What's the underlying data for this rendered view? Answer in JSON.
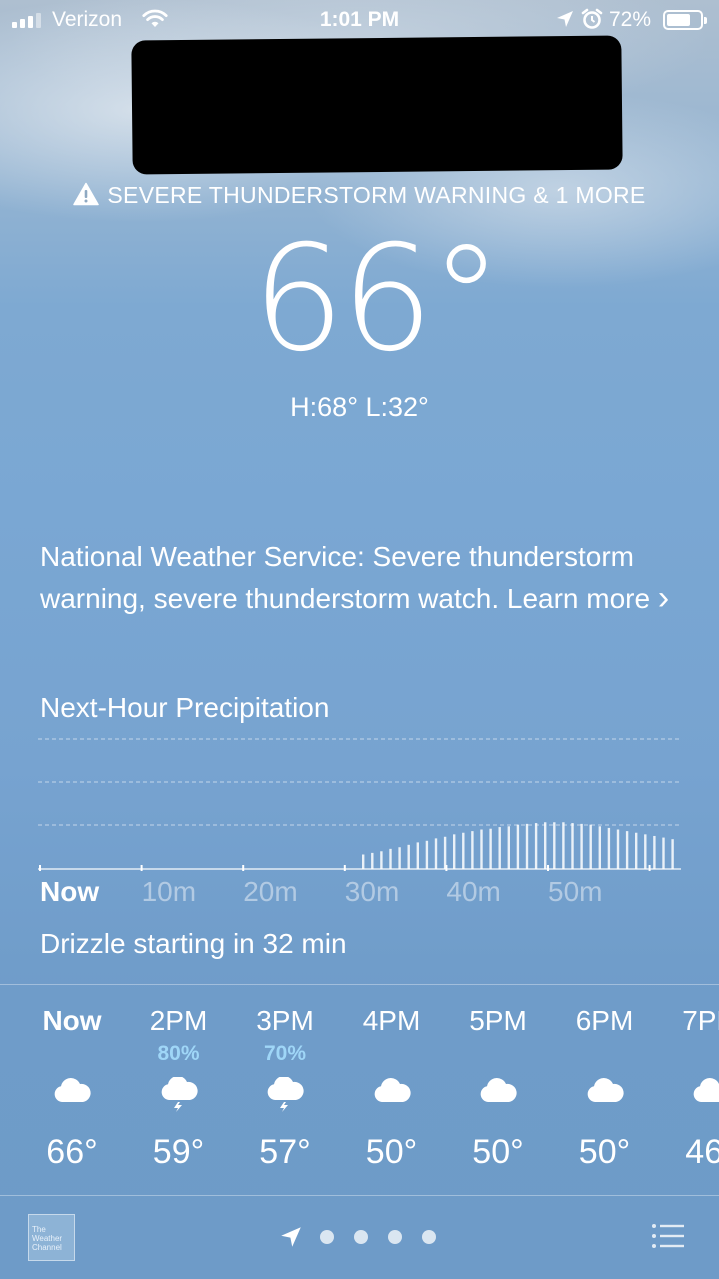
{
  "status_bar": {
    "carrier": "Verizon",
    "time": "1:01 PM",
    "battery_percent": "72%",
    "battery_level": 0.72
  },
  "warning": {
    "icon": "warning-triangle-icon",
    "text": "SEVERE THUNDERSTORM WARNING & 1 MORE"
  },
  "current": {
    "temperature": "66°",
    "high_low": "H:68°  L:32°"
  },
  "alert": {
    "text": "National Weather Service: Severe thunderstorm warning, severe thunderstorm watch. Learn more",
    "chevron": "›"
  },
  "precipitation": {
    "title": "Next-Hour Precipitation",
    "axis_labels": [
      "Now",
      "10m",
      "20m",
      "30m",
      "40m",
      "50m"
    ],
    "summary": "Drizzle starting in 32 min",
    "intensity_by_minute_from_32": [
      0.18,
      0.2,
      0.22,
      0.25,
      0.27,
      0.3,
      0.33,
      0.35,
      0.38,
      0.4,
      0.43,
      0.45,
      0.47,
      0.49,
      0.5,
      0.52,
      0.53,
      0.55,
      0.56,
      0.57,
      0.58,
      0.58,
      0.58,
      0.57,
      0.56,
      0.55,
      0.53,
      0.51,
      0.49,
      0.47,
      0.45,
      0.43,
      0.41,
      0.39,
      0.37
    ]
  },
  "hourly": [
    {
      "time": "Now",
      "pop": "",
      "icon": "cloud-icon",
      "temp": "66°"
    },
    {
      "time": "2PM",
      "pop": "80%",
      "icon": "thunderstorm-icon",
      "temp": "59°"
    },
    {
      "time": "3PM",
      "pop": "70%",
      "icon": "thunderstorm-icon",
      "temp": "57°"
    },
    {
      "time": "4PM",
      "pop": "",
      "icon": "cloud-icon",
      "temp": "50°"
    },
    {
      "time": "5PM",
      "pop": "",
      "icon": "cloud-icon",
      "temp": "50°"
    },
    {
      "time": "6PM",
      "pop": "",
      "icon": "cloud-icon",
      "temp": "50°"
    },
    {
      "time": "7PM",
      "pop": "",
      "icon": "cloud-icon",
      "temp": "46°"
    }
  ],
  "tab_bar": {
    "logo_text": "The Weather Channel",
    "pages": 4
  }
}
